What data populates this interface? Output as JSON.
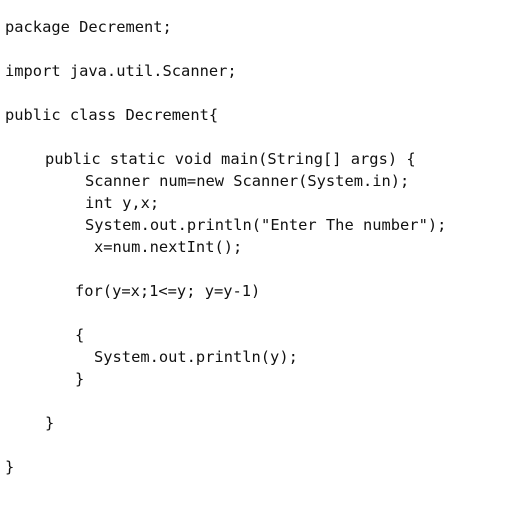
{
  "code": {
    "lines": [
      "package Decrement;",
      "import java.util.Scanner;",
      "public class Decrement{",
      "public static void main(String[] args) {",
      "Scanner num=new Scanner(System.in);",
      "int y,x;",
      "System.out.println(\"Enter The number\");",
      "x=num.nextInt();",
      "for(y=x;1<=y; y=y-1)",
      "{",
      "System.out.println(y);",
      "}",
      "}",
      "}"
    ]
  }
}
